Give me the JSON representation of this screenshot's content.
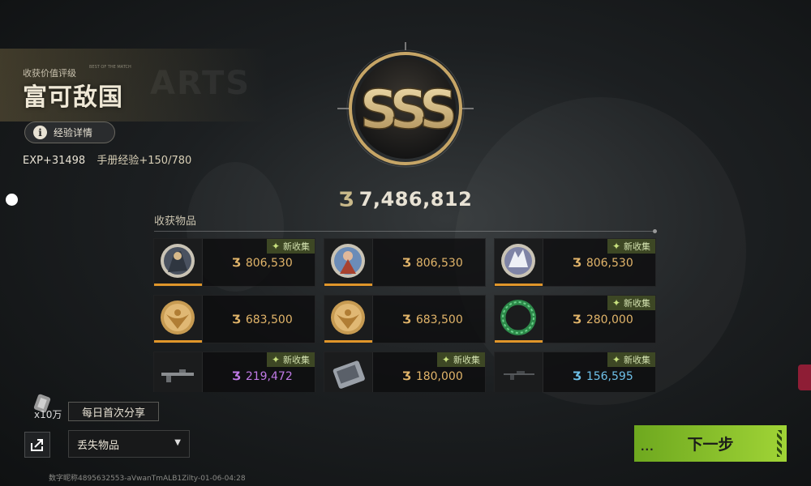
{
  "header": {
    "rank_label": "收获价值评级",
    "rank_sub": "BEST OF THE MATCH",
    "rank_title": "富可敌国",
    "exp_details_label": "经验详情",
    "exp_value": "EXP+31498",
    "manual_exp": "手册经验+150/780"
  },
  "emblem": {
    "grade": "SSS"
  },
  "total_value": "7,486,812",
  "items": {
    "label": "收获物品",
    "new_badge": "新收集",
    "list": [
      {
        "value": "806,530",
        "value_color": "#e2b56a",
        "new": true,
        "art": "coin-warrior-icon",
        "rarity": "#e0962a"
      },
      {
        "value": "806,530",
        "value_color": "#e2b56a",
        "new": false,
        "art": "coin-heroine-icon",
        "rarity": "#e0962a"
      },
      {
        "value": "806,530",
        "value_color": "#e2b56a",
        "new": true,
        "art": "coin-white-beast-icon",
        "rarity": "#e0962a"
      },
      {
        "value": "683,500",
        "value_color": "#e2b56a",
        "new": false,
        "art": "coin-gold-eagle-icon",
        "rarity": "#e0962a"
      },
      {
        "value": "683,500",
        "value_color": "#e2b56a",
        "new": false,
        "art": "coin-gold-eagle-icon",
        "rarity": "#e0962a"
      },
      {
        "value": "280,000",
        "value_color": "#e2b56a",
        "new": true,
        "art": "jade-ring-icon",
        "rarity": "#e0962a"
      },
      {
        "value": "219,472",
        "value_color": "#c07ae6",
        "new": true,
        "art": "rifle-icon",
        "rarity": "#9b5bd0"
      },
      {
        "value": "180,000",
        "value_color": "#e2b56a",
        "new": true,
        "art": "card-device-icon",
        "rarity": "#e0962a"
      },
      {
        "value": "156,595",
        "value_color": "#6ec0e8",
        "new": true,
        "art": "sniper-rifle-icon",
        "rarity": "#4aa0d0"
      }
    ]
  },
  "share": {
    "count": "x10万",
    "daily_label": "每日首次分享"
  },
  "lost_items": {
    "label": "丢失物品"
  },
  "next_button": {
    "label": "下一步"
  },
  "watermark": "数字昵称4895632553-aVwanTmALB1Zilty-01-06-04:28",
  "colors": {
    "accent_green": "#a0d436",
    "gold": "#c9b98a",
    "value_gold": "#e2b56a"
  }
}
